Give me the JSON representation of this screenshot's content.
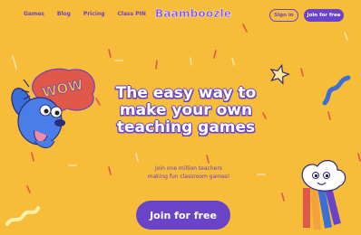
{
  "nav": {
    "links": [
      "Games",
      "Blog",
      "Pricing",
      "Class PIN"
    ],
    "logo": "Baamboozle",
    "signin_label": "Sign in",
    "join_label": "Join for free"
  },
  "hero": {
    "headline_lines": [
      "The easy way to",
      "make your own",
      "teaching games"
    ],
    "subline_lines": [
      "Join one million teachers",
      "making fun classroom games!"
    ],
    "cta_label": "Join for free",
    "wow_label": "WOW"
  },
  "colors": {
    "background": "#f6bc3a",
    "brand_purple": "#6a44c8",
    "cta_text": "#ffffff"
  },
  "icons": [
    "dog-mascot-icon",
    "wow-speech-bubble-icon",
    "star-icon",
    "rainbow-cloud-mascot-icon",
    "squiggle-icon"
  ]
}
